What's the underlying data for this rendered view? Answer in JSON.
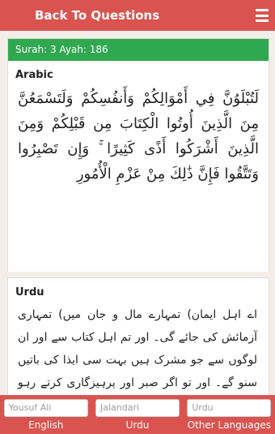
{
  "header": {
    "back_label": "Back To Questions",
    "menu_icon": "hamburger-menu-icon"
  },
  "reference": "Surah: 3 Ayah: 186",
  "arabic": {
    "title": "Arabic",
    "text": "لَتُبْلَوُنَّ فِي أَمْوَالِكُمْ وَأَنفُسِكُمْ وَلَتَسْمَعُنَّ مِنَ الَّذِينَ أُوتُوا الْكِتَابَ مِن قَبْلِكُمْ وَمِنَ الَّذِينَ أَشْرَكُوا أَذًى كَثِيرًا ۚ وَإِن تَصْبِرُوا وَتَتَّقُوا فَإِنَّ ذَٰلِكَ مِنْ عَزْمِ الْأُمُورِ"
  },
  "urdu": {
    "title": "Urdu",
    "text": "اے اہل ایمان) تمہارے مال و جان میں) تمہاری آزمائش کی جائے گی۔ اور تم اہل کتاب سے اور ان لوگوں سے جو مشرک ہیں بہت سی ایذا کی باتیں سنو گے۔ اور تو اگر صبر اور پرہیزگاری کرتے رہو گے تو یہ بڑی ہمت کے کام ہیں"
  },
  "translators": [
    {
      "value": "Yousuf Ali",
      "label": "English"
    },
    {
      "value": "Jalandari",
      "label": "Urdu"
    },
    {
      "value": "Urdu",
      "label": "Other Languages"
    }
  ]
}
